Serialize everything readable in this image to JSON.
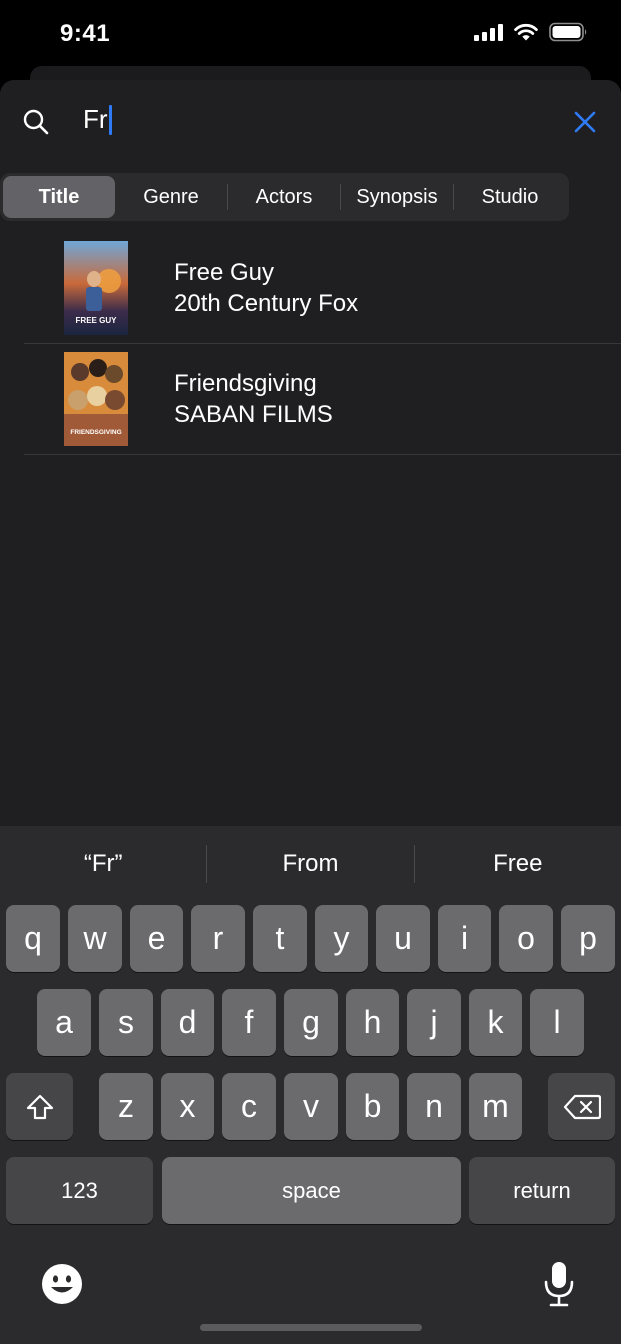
{
  "status_bar": {
    "time": "9:41"
  },
  "search": {
    "query": "Fr"
  },
  "filters": {
    "tabs": [
      {
        "label": "Title",
        "active": true
      },
      {
        "label": "Genre",
        "active": false
      },
      {
        "label": "Actors",
        "active": false
      },
      {
        "label": "Synopsis",
        "active": false
      },
      {
        "label": "Studio",
        "active": false
      }
    ]
  },
  "results": [
    {
      "title": "Free Guy",
      "studio": "20th Century Fox",
      "poster_text": "FREE GUY"
    },
    {
      "title": "Friendsgiving",
      "studio": "SABAN FILMS",
      "poster_text": "FRIENDSGIVING"
    }
  ],
  "keyboard": {
    "suggestions": [
      "“Fr”",
      "From",
      "Free"
    ],
    "row1": [
      "q",
      "w",
      "e",
      "r",
      "t",
      "y",
      "u",
      "i",
      "o",
      "p"
    ],
    "row2": [
      "a",
      "s",
      "d",
      "f",
      "g",
      "h",
      "j",
      "k",
      "l"
    ],
    "row3": [
      "z",
      "x",
      "c",
      "v",
      "b",
      "n",
      "m"
    ],
    "numbers_label": "123",
    "space_label": "space",
    "return_label": "return"
  },
  "colors": {
    "accent": "#2f7bf6",
    "sheet": "#1f1f21",
    "keyboard": "#2b2b2d"
  }
}
